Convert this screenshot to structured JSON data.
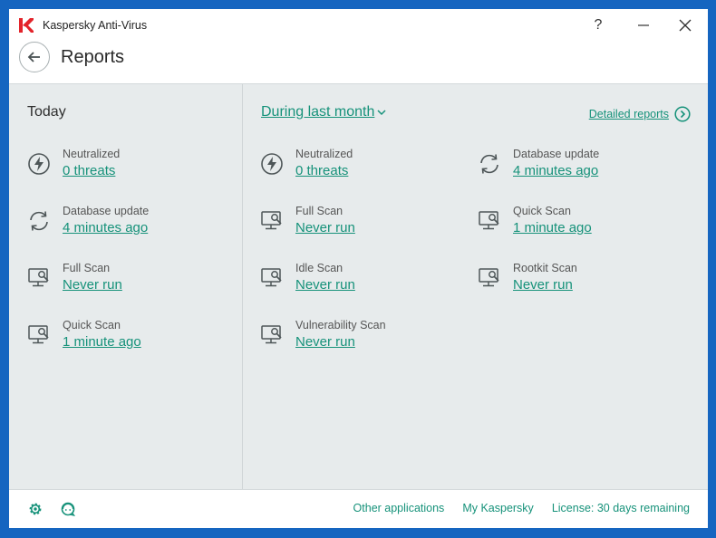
{
  "window": {
    "title": "Kaspersky Anti-Virus",
    "help_label": "?"
  },
  "header": {
    "title": "Reports"
  },
  "today": {
    "title": "Today",
    "stats": [
      {
        "icon": "lightning-icon",
        "label": "Neutralized",
        "value": "0 threats"
      },
      {
        "icon": "refresh-icon",
        "label": "Database update",
        "value": "4 minutes ago"
      },
      {
        "icon": "monitor-scan-icon",
        "label": "Full Scan",
        "value": "Never run"
      },
      {
        "icon": "monitor-scan-icon",
        "label": "Quick Scan",
        "value": "1 minute ago"
      }
    ]
  },
  "period": {
    "selected": "During last month",
    "detailed_reports_label": "Detailed reports",
    "stats": [
      {
        "icon": "lightning-icon",
        "label": "Neutralized",
        "value": "0 threats"
      },
      {
        "icon": "refresh-icon",
        "label": "Database update",
        "value": "4 minutes ago"
      },
      {
        "icon": "monitor-scan-icon",
        "label": "Full Scan",
        "value": "Never run"
      },
      {
        "icon": "monitor-scan-icon",
        "label": "Quick Scan",
        "value": "1 minute ago"
      },
      {
        "icon": "monitor-scan-icon",
        "label": "Idle Scan",
        "value": "Never run"
      },
      {
        "icon": "monitor-scan-icon",
        "label": "Rootkit Scan",
        "value": "Never run"
      },
      {
        "icon": "monitor-scan-icon",
        "label": "Vulnerability Scan",
        "value": "Never run"
      }
    ]
  },
  "footer": {
    "links": [
      "Other applications",
      "My Kaspersky",
      "License: 30 days remaining"
    ]
  },
  "colors": {
    "accent": "#16927a",
    "content_bg": "#e7ebec",
    "frame": "#1565c0",
    "brand_red": "#e3242b"
  }
}
